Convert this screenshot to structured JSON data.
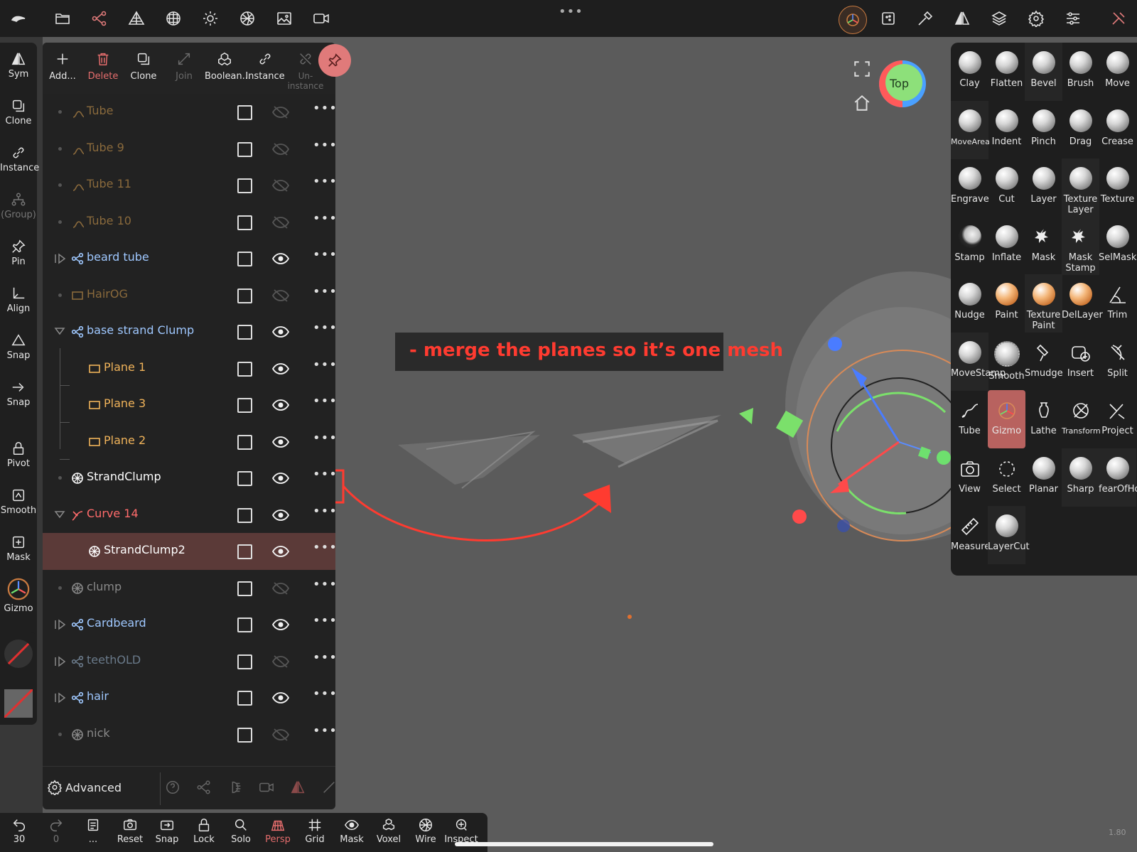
{
  "topbar": {
    "more_dots": "•••",
    "left_icons": [
      "app-logo-icon",
      "folder-icon",
      "scene-graph-icon",
      "mesh-pyramid-icon",
      "texture-grid-icon",
      "sun-icon",
      "material-icon",
      "image-icon",
      "camera-icon"
    ],
    "right_icons": [
      "gizmo-orbit-icon",
      "dotted-square-icon",
      "hammer-icon",
      "symmetry-icon",
      "layers-icon",
      "gear-icon",
      "sliders-icon",
      "tools-icon"
    ]
  },
  "left_toolbar": {
    "items": [
      {
        "label": "Sym"
      },
      {
        "label": "Clone"
      },
      {
        "label": "Instance"
      },
      {
        "label": "(Group)"
      },
      {
        "label": "Pin"
      },
      {
        "label": "Align"
      },
      {
        "label": "Snap"
      },
      {
        "label": "Snap"
      },
      {
        "label": "Pivot"
      },
      {
        "label": "Smooth"
      },
      {
        "label": "Mask"
      },
      {
        "label": "Gizmo"
      }
    ]
  },
  "scene_toolbar": {
    "add": "Add...",
    "delete": "Delete",
    "clone": "Clone",
    "join": "Join",
    "boolean": "Boolean...",
    "instance": "Instance",
    "uninstance": "Un-instance"
  },
  "scene_rows": [
    {
      "name": "Tube",
      "type": "tube",
      "visible": false,
      "dim": true
    },
    {
      "name": "Tube 9",
      "type": "tube",
      "visible": false,
      "dim": true
    },
    {
      "name": "Tube 11",
      "type": "tube",
      "visible": false,
      "dim": true
    },
    {
      "name": "Tube 10",
      "type": "tube",
      "visible": false,
      "dim": true
    },
    {
      "name": "beard tube",
      "type": "group",
      "visible": true
    },
    {
      "name": "HairOG",
      "type": "plane",
      "visible": false,
      "dim": true
    },
    {
      "name": "base strand Clump",
      "type": "group",
      "visible": true,
      "expanded": true
    },
    {
      "name": "Plane 1",
      "type": "plane",
      "visible": true,
      "child": true
    },
    {
      "name": "Plane 3",
      "type": "plane",
      "visible": true,
      "child": true
    },
    {
      "name": "Plane 2",
      "type": "plane",
      "visible": true,
      "child": true
    },
    {
      "name": "StrandClump",
      "type": "mesh",
      "visible": true
    },
    {
      "name": "Curve 14",
      "type": "curve",
      "visible": true,
      "expanded": true
    },
    {
      "name": "StrandClump2",
      "type": "mesh",
      "visible": true,
      "child": true,
      "selected": true
    },
    {
      "name": "clump",
      "type": "mesh",
      "visible": false,
      "dim": true
    },
    {
      "name": "Cardbeard",
      "type": "group",
      "visible": true
    },
    {
      "name": "teethOLD",
      "type": "group",
      "visible": false,
      "dim": true
    },
    {
      "name": "hair",
      "type": "group",
      "visible": true
    },
    {
      "name": "nick",
      "type": "mesh",
      "visible": false,
      "dim": true
    }
  ],
  "scene_footer": {
    "advanced": "Advanced"
  },
  "bottom_toolbar": [
    {
      "label": "30",
      "icon": "undo-icon"
    },
    {
      "label": "0",
      "icon": "redo-icon"
    },
    {
      "label": "...",
      "icon": "notes-icon"
    },
    {
      "label": "Reset",
      "icon": "reset-camera-icon"
    },
    {
      "label": "Snap",
      "icon": "snap-camera-icon"
    },
    {
      "label": "Lock",
      "icon": "lock-icon"
    },
    {
      "label": "Solo",
      "icon": "search-icon"
    },
    {
      "label": "Persp",
      "icon": "perspective-icon"
    },
    {
      "label": "Grid",
      "icon": "grid-icon"
    },
    {
      "label": "Mask",
      "icon": "eye-icon"
    },
    {
      "label": "Voxel",
      "icon": "voxel-icon"
    },
    {
      "label": "Wire",
      "icon": "wireframe-icon"
    },
    {
      "label": "Inspect",
      "icon": "inspect-icon"
    }
  ],
  "tools": [
    {
      "label": "Clay",
      "style": "ball"
    },
    {
      "label": "Flatten",
      "style": "ball"
    },
    {
      "label": "Bevel",
      "style": "ball"
    },
    {
      "label": "Brush",
      "style": "ball"
    },
    {
      "label": "Move",
      "style": "ball"
    },
    {
      "label": "MoveArea",
      "style": "ball",
      "small": true
    },
    {
      "label": "Indent",
      "style": "ball"
    },
    {
      "label": "Pinch",
      "style": "ball"
    },
    {
      "label": "Drag",
      "style": "ball"
    },
    {
      "label": "Crease",
      "style": "ball"
    },
    {
      "label": "Engrave",
      "style": "ball"
    },
    {
      "label": "Cut",
      "style": "ball"
    },
    {
      "label": "Layer",
      "style": "ball"
    },
    {
      "label": "Texture Layer",
      "style": "ball"
    },
    {
      "label": "Texture",
      "style": "ball"
    },
    {
      "label": "Stamp",
      "style": "dark"
    },
    {
      "label": "Inflate",
      "style": "ball"
    },
    {
      "label": "Mask",
      "style": "icon"
    },
    {
      "label": "Mask Stamp",
      "style": "icon"
    },
    {
      "label": "SelMask",
      "style": "ball"
    },
    {
      "label": "Nudge",
      "style": "ball"
    },
    {
      "label": "Paint",
      "style": "orange"
    },
    {
      "label": "Texture Paint",
      "style": "orange"
    },
    {
      "label": "DelLayer",
      "style": "orange"
    },
    {
      "label": "Trim",
      "style": "icon"
    },
    {
      "label": "MoveStamp",
      "style": "ball"
    },
    {
      "label": "Smooth",
      "style": "speck"
    },
    {
      "label": "Smudge",
      "style": "icon"
    },
    {
      "label": "Insert",
      "style": "icon"
    },
    {
      "label": "Split",
      "style": "icon"
    },
    {
      "label": "Tube",
      "style": "icon"
    },
    {
      "label": "Gizmo",
      "style": "icon",
      "active": true
    },
    {
      "label": "Lathe",
      "style": "icon"
    },
    {
      "label": "Transform",
      "style": "icon",
      "small": true
    },
    {
      "label": "Project",
      "style": "icon"
    },
    {
      "label": "View",
      "style": "icon"
    },
    {
      "label": "Select",
      "style": "icon"
    },
    {
      "label": "Planar",
      "style": "ball"
    },
    {
      "label": "Sharp",
      "style": "ball"
    },
    {
      "label": "fearOfHolw",
      "style": "ball"
    },
    {
      "label": "Measure",
      "style": "icon"
    },
    {
      "label": "LayerCut",
      "style": "ball"
    }
  ],
  "navigation": {
    "cube_label": "Top"
  },
  "annotation": {
    "text": "- merge the planes so it’s one mesh"
  },
  "corner_readout": "1.80",
  "colors": {
    "accent_red": "#e07a7a",
    "selected_row": "#5b3a38",
    "annotation_red": "#ff3b30",
    "group_blue": "#9fc8ff",
    "plane_orange": "#f0b35a",
    "curve_red": "#ff6b6b"
  }
}
